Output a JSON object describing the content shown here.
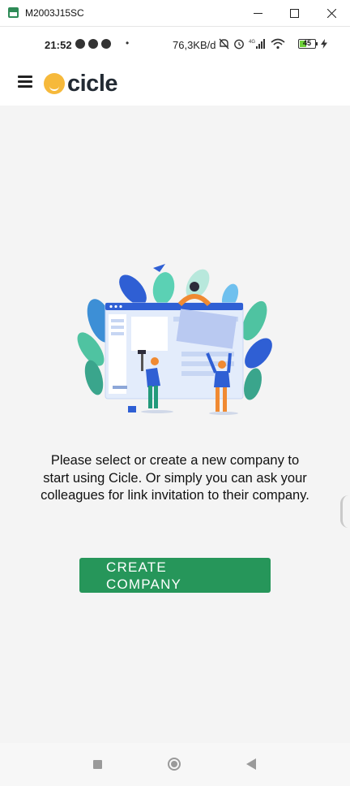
{
  "window": {
    "title": "M2003J15SC",
    "icons": [
      "app-icon",
      "minimize-icon",
      "maximize-icon",
      "close-icon"
    ]
  },
  "status_bar": {
    "time": "21:52",
    "network_speed": "76,3KB/d",
    "network_type": "4G",
    "battery_level": "45",
    "battery_fraction": 0.45
  },
  "app_bar": {
    "logo_text": "cicle",
    "menu_icon": "hamburger-menu-icon"
  },
  "main": {
    "message": "Please select or create a new company to start using Cicle. Or simply you can ask your colleagues for link invitation to their company.",
    "create_button_label": "CREATE COMPANY"
  },
  "colors": {
    "accent": "#26965a",
    "logo_yellow": "#f6b93b",
    "illustration_blue": "#2f5fd4"
  },
  "nav_bar": {
    "icons": [
      "recent-apps-icon",
      "home-icon",
      "back-icon"
    ]
  }
}
